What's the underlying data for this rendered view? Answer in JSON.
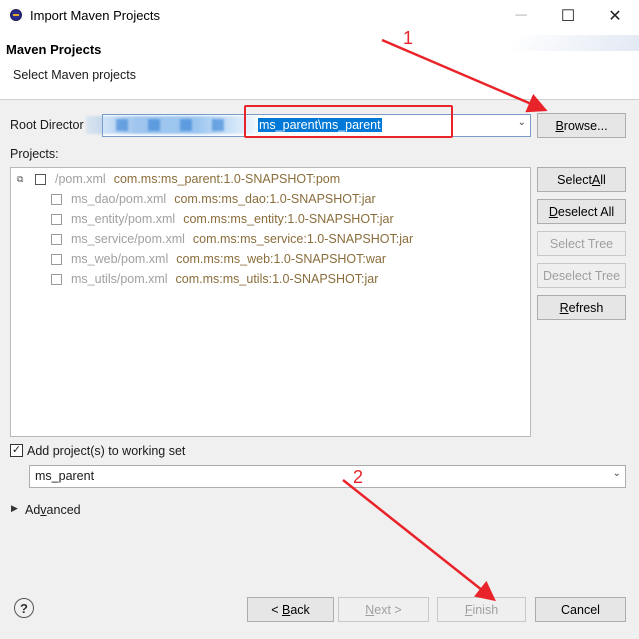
{
  "window": {
    "title": "Import Maven Projects",
    "minimize": "─",
    "maximize": "☐",
    "close": "✕"
  },
  "header": {
    "title": "Maven Projects",
    "subtitle": "Select Maven projects"
  },
  "root": {
    "label": "Root Director",
    "value": "ms_parent\\ms_parent",
    "browse_pre": "",
    "browse_u": "B",
    "browse_post": "rowse..."
  },
  "projects_label": "Projects:",
  "tree": {
    "parent": {
      "path": "/pom.xml",
      "coord": "com.ms:ms_parent:1.0-SNAPSHOT:pom"
    },
    "children": [
      {
        "path": "ms_dao/pom.xml",
        "coord": "com.ms:ms_dao:1.0-SNAPSHOT:jar"
      },
      {
        "path": "ms_entity/pom.xml",
        "coord": "com.ms:ms_entity:1.0-SNAPSHOT:jar"
      },
      {
        "path": "ms_service/pom.xml",
        "coord": "com.ms:ms_service:1.0-SNAPSHOT:jar"
      },
      {
        "path": "ms_web/pom.xml",
        "coord": "com.ms:ms_web:1.0-SNAPSHOT:war"
      },
      {
        "path": "ms_utils/pom.xml",
        "coord": "com.ms:ms_utils:1.0-SNAPSHOT:jar"
      }
    ]
  },
  "side_buttons": {
    "select_all": {
      "pre": "Select ",
      "u": "A",
      "post": "ll"
    },
    "deselect_all": {
      "pre": "",
      "u": "D",
      "post": "eselect All"
    },
    "select_tree": "Select Tree",
    "deselect_tree": "Deselect Tree",
    "refresh": {
      "pre": "",
      "u": "R",
      "post": "efresh"
    }
  },
  "working_set": {
    "checkbox_label": "Add project(s) to working set",
    "checked": true,
    "value": "ms_parent"
  },
  "advanced": {
    "pre": "Ad",
    "u": "v",
    "post": "anced"
  },
  "annotations": {
    "one": "1",
    "two": "2",
    "color": "#e8242a"
  },
  "footer": {
    "help": "?",
    "back": {
      "pre": "< ",
      "u": "B",
      "post": "ack"
    },
    "next": {
      "pre": "",
      "u": "N",
      "post": "ext >"
    },
    "finish": {
      "pre": "",
      "u": "F",
      "post": "inish"
    },
    "cancel": "Cancel"
  }
}
